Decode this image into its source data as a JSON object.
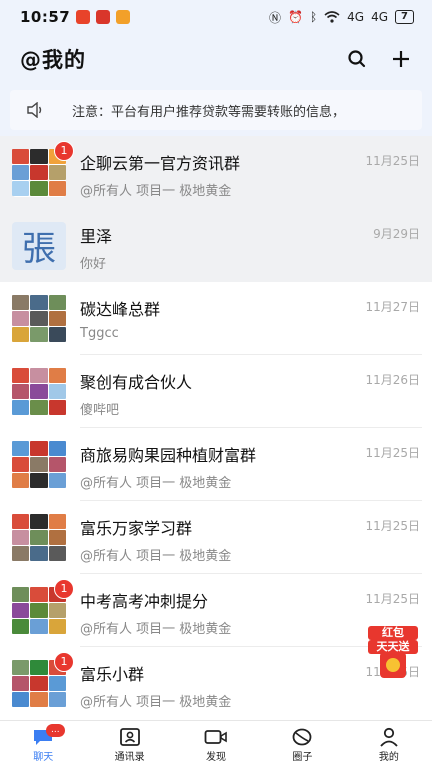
{
  "status_bar": {
    "time": "10:57",
    "signal1": "4G",
    "signal2": "4G",
    "battery": "7"
  },
  "header": {
    "title": "@我的"
  },
  "notice": {
    "text": "注意：平台有用户推荐贷款等需要转账的信息，"
  },
  "chats": [
    {
      "name": "企聊云第一官方资讯群",
      "message": "@所有人 项目一 极地黄金",
      "date": "11月25日",
      "badge": "1",
      "pinned": true
    },
    {
      "name": "里泽",
      "message": "你好",
      "date": "9月29日",
      "badge": "",
      "pinned": true
    },
    {
      "name": "碳达峰总群",
      "message": "Tggcc",
      "date": "11月27日",
      "badge": "",
      "pinned": false
    },
    {
      "name": "聚创有成合伙人",
      "message": "傻哔吧",
      "date": "11月26日",
      "badge": "",
      "pinned": false
    },
    {
      "name": "商旅易购果园种植财富群",
      "message": "@所有人 项目一 极地黄金",
      "date": "11月25日",
      "badge": "",
      "pinned": false
    },
    {
      "name": "富乐万家学习群",
      "message": "@所有人 项目一 极地黄金",
      "date": "11月25日",
      "badge": "",
      "pinned": false
    },
    {
      "name": "中考高考冲刺提分",
      "message": "@所有人 项目一 极地黄金",
      "date": "11月25日",
      "badge": "1",
      "pinned": false
    },
    {
      "name": "富乐小群",
      "message": "@所有人 项目一 极地黄金",
      "date": "11月25日",
      "badge": "1",
      "pinned": false
    }
  ],
  "avatar_single_char": "張",
  "promo": {
    "line1": "红包",
    "line2": "天天送"
  },
  "tabs": [
    {
      "label": "聊天",
      "icon": "chat-icon",
      "active": true,
      "badge": "..."
    },
    {
      "label": "通讯录",
      "icon": "contacts-icon",
      "active": false
    },
    {
      "label": "发现",
      "icon": "video-icon",
      "active": false
    },
    {
      "label": "圈子",
      "icon": "circle-icon",
      "active": false
    },
    {
      "label": "我的",
      "icon": "profile-icon",
      "active": false
    }
  ],
  "colors": {
    "accent": "#3b7ef2",
    "badge": "#e8372e",
    "header_bg": "#eef3fc"
  }
}
